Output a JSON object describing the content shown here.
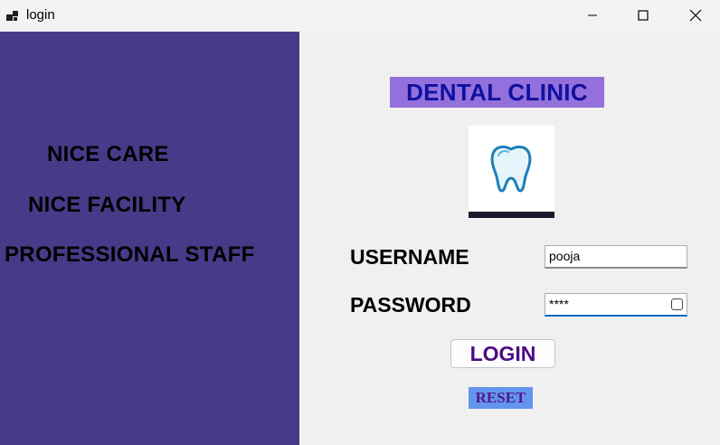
{
  "window": {
    "title": "login"
  },
  "colors": {
    "left_panel_bg": "#473a88",
    "clinic_title_bg": "#9370db",
    "clinic_title_fg": "#1010a0",
    "login_fg": "#4b0a82",
    "reset_bg": "#6495ed",
    "reset_fg": "#4b1a8c"
  },
  "left_panel": {
    "slogans": [
      "NICE CARE",
      "NICE FACILITY",
      "PROFESSIONAL STAFF"
    ]
  },
  "form": {
    "clinic_title": "DENTAL CLINIC",
    "logo_icon": "tooth-icon",
    "username_label": "USERNAME",
    "username_value": "pooja",
    "password_label": "PASSWORD",
    "password_value": "****",
    "login_label": "LOGIN",
    "reset_label": "RESET"
  }
}
